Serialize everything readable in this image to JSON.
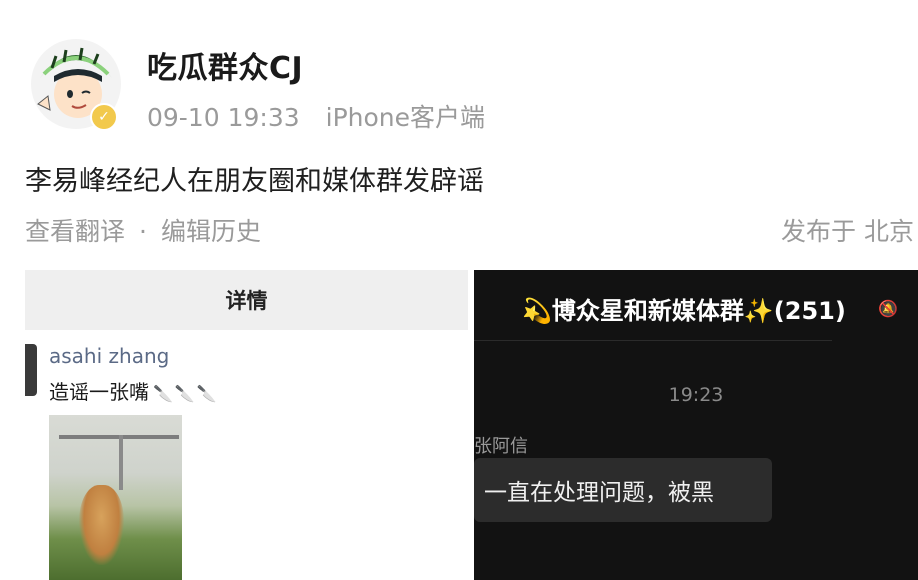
{
  "post": {
    "username": "吃瓜群众CJ",
    "timestamp": "09-10 19:33",
    "source": "iPhone客户端",
    "text": "李易峰经纪人在朋友圈和媒体群发辟谣",
    "translate_label": "查看翻译",
    "separator": "·",
    "edit_history_label": "编辑历史",
    "location": "发布于 北京",
    "badge_icon": "verified-badge-icon"
  },
  "left_screenshot": {
    "header": "详情",
    "commenter_name": "asahi zhang",
    "comment_text": "造谣一张嘴",
    "comment_emoji": "kitchen-knife-icon ×3"
  },
  "right_screenshot": {
    "group_title": "博众星和新媒体群",
    "group_count": "(251)",
    "time": "19:23",
    "sender": "张阿信",
    "message": "一直在处理问题，被黑"
  }
}
